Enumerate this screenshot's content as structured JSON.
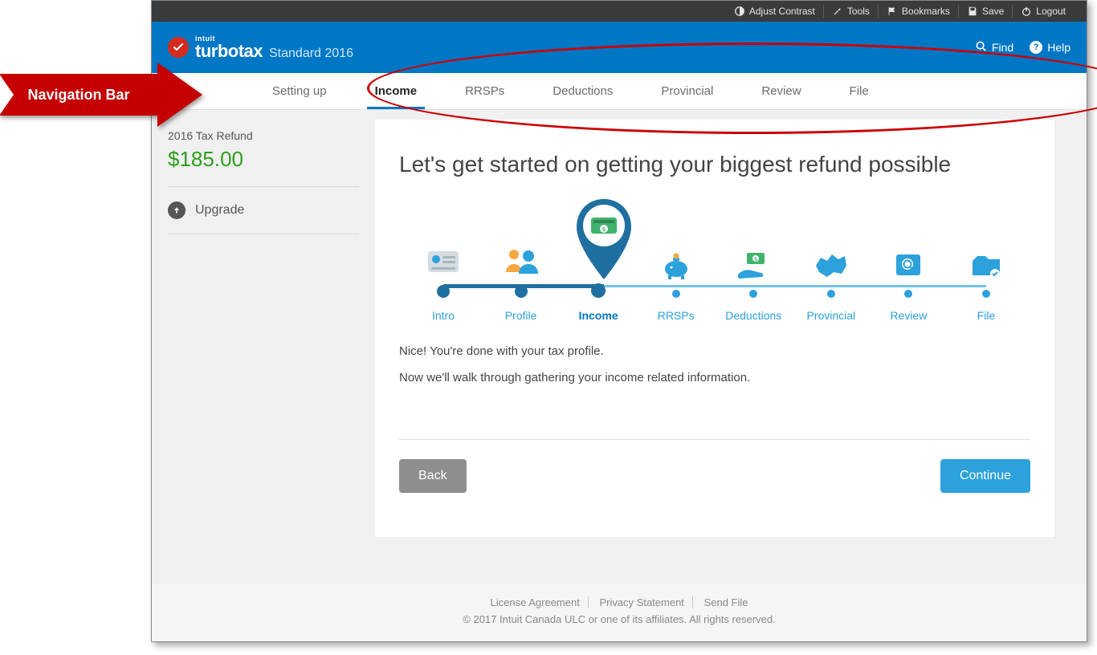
{
  "utilbar": {
    "adjust_contrast": "Adjust Contrast",
    "tools": "Tools",
    "bookmarks": "Bookmarks",
    "save": "Save",
    "logout": "Logout"
  },
  "brand": {
    "intuit": "intuit",
    "product": "turbotax",
    "edition": "Standard 2016",
    "find": "Find",
    "help": "Help"
  },
  "nav": {
    "items": [
      "Setting up",
      "Income",
      "RRSPs",
      "Deductions",
      "Provincial",
      "Review",
      "File"
    ],
    "active_index": 1
  },
  "sidebar": {
    "refund_label": "2016 Tax Refund",
    "refund_amount": "$185.00",
    "upgrade": "Upgrade"
  },
  "card": {
    "heading": "Let's get started on getting your biggest refund possible",
    "line1": "Nice! You're done with your tax profile.",
    "line2": "Now we'll walk through gathering your income related information.",
    "back": "Back",
    "continue": "Continue"
  },
  "steps": {
    "items": [
      "Intro",
      "Profile",
      "Income",
      "RRSPs",
      "Deductions",
      "Provincial",
      "Review",
      "File"
    ],
    "current_index": 2
  },
  "footer": {
    "license": "License Agreement",
    "privacy": "Privacy Statement",
    "sendfile": "Send File",
    "copyright": "© 2017 Intuit Canada ULC or one of its affiliates. All rights reserved."
  },
  "callout": {
    "label": "Navigation Bar"
  }
}
